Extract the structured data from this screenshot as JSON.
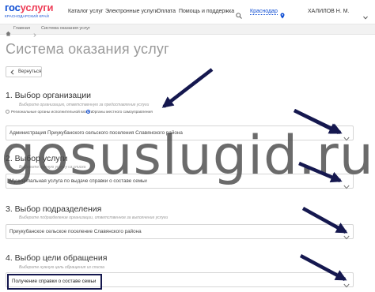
{
  "header": {
    "logo_main_gos": "гос",
    "logo_main_usl": "услуги",
    "logo_sub": "КРАСНОДАРСКИЙ КРАЙ",
    "nav": [
      "Каталог услуг",
      "Электронные услуги",
      "Оплата",
      "Помощь и поддержка"
    ],
    "search_icon": "search-icon",
    "city": "Краснодар",
    "city_icon": "location-pin-icon",
    "user": "ХАЛИЛОВ Н. М."
  },
  "breadcrumb": {
    "home_icon": "home-icon",
    "items": [
      "Главная",
      "Система оказания услуг"
    ]
  },
  "page": {
    "title": "Система оказания услуг",
    "back_label": "Вернуться"
  },
  "steps": [
    {
      "title": "1. Выбор организации",
      "hint": "Выберите организацию, ответственную за предоставление услуги",
      "radios": [
        {
          "label": "Региональные органы исполнительной власти",
          "selected": false
        },
        {
          "label": "Органы местного самоуправления",
          "selected": true
        }
      ],
      "value": "Администрация Приукубанского сельского поселения Славянского района"
    },
    {
      "title": "2. Выбор услуги",
      "hint": "Выберите нужную услугу из списка",
      "value": "Муниципальная услуга по выдаче справки о составе семьи"
    },
    {
      "title": "3. Выбор подразделения",
      "hint": "Выберите подразделение организации, ответственное за выполнение услуги",
      "value": "Приукубанское сельское поселение Славянского района"
    },
    {
      "title": "4. Выбор цели обращения",
      "hint": "Выберите нужную цель обращения из списка",
      "value": "Получение справки о составе семьи"
    }
  ],
  "watermark": "gosuslugid.ru",
  "colors": {
    "brand_blue": "#0d4cd3",
    "brand_red": "#ee3f58",
    "annotation_navy": "#15184f",
    "title_grey": "#9b9b9b"
  }
}
